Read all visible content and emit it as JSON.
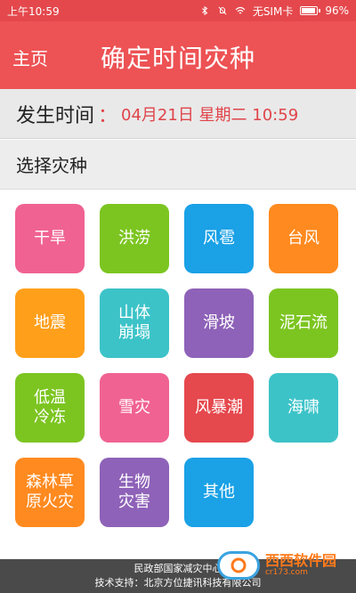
{
  "status_bar": {
    "time": "上午10:59",
    "sim_text": "无SIM卡",
    "battery": "96%",
    "battery_level": 0.96,
    "icons": [
      "bluetooth-icon",
      "mute-icon",
      "wifi-icon",
      "battery-icon"
    ]
  },
  "app_bar": {
    "home_label": "主页",
    "title": "确定时间灾种"
  },
  "occurrence": {
    "label": "发生时间",
    "colon": "：",
    "value": "04月21日 星期二 10:59"
  },
  "disaster_section": {
    "title": "选择灾种"
  },
  "disaster_types": [
    {
      "label": "干旱",
      "color": "#f06292"
    },
    {
      "label": "洪涝",
      "color": "#7cc521"
    },
    {
      "label": "风雹",
      "color": "#1aa1e6"
    },
    {
      "label": "台风",
      "color": "#ff8a1f"
    },
    {
      "label": "地震",
      "color": "#ff9f1a"
    },
    {
      "label": "山体\n崩塌",
      "color": "#3cc3c8"
    },
    {
      "label": "滑坡",
      "color": "#8e62b8"
    },
    {
      "label": "泥石流",
      "color": "#7cc521"
    },
    {
      "label": "低温\n冷冻",
      "color": "#7cc521"
    },
    {
      "label": "雪灾",
      "color": "#f06292"
    },
    {
      "label": "风暴潮",
      "color": "#e5484d"
    },
    {
      "label": "海啸",
      "color": "#3cc3c8"
    },
    {
      "label": "森林草\n原火灾",
      "color": "#ff8a1f"
    },
    {
      "label": "生物\n灾害",
      "color": "#8e62b8"
    },
    {
      "label": "其他",
      "color": "#1aa1e6"
    }
  ],
  "footer": {
    "line1": "民政部国家减灾中心",
    "line2": "技术支持：北京方位捷讯科技有限公司"
  },
  "watermark": {
    "brand": "西西软件园",
    "site": "cr173.com"
  }
}
